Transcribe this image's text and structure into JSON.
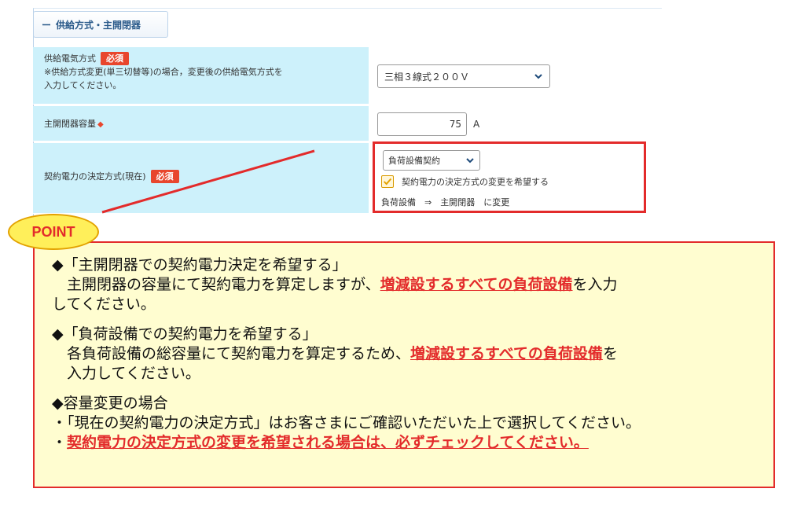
{
  "section": {
    "title": "供給方式・主開閉器",
    "collapse_symbol": "ー"
  },
  "rows": {
    "supply_method": {
      "label": "供給電気方式",
      "required": "必須",
      "note_line1": "※供給方式変更(単三切替等)の場合，変更後の供給電気方式を",
      "note_line2": "入力してください。",
      "select_value": "三相３線式２００Ｖ"
    },
    "main_switch_capacity": {
      "label": "主開閉器容量",
      "marker": "◆",
      "value": "75",
      "unit": "A"
    },
    "contract_method": {
      "label": "契約電力の決定方式(現在)",
      "required": "必須",
      "select_value": "負荷設備契約",
      "checkbox_label": "契約電力の決定方式の変更を希望する",
      "checkbox_checked": true,
      "change_text": "負荷設備　⇒　主開閉器　に変更"
    }
  },
  "point": {
    "badge": "POINT",
    "p1_heading": "◆「主開閉器での契約電力決定を希望する」",
    "p1_line_pre": "　主開閉器の容量にて契約電力を算定しますが、",
    "p1_highlight": "増減設するすべての負荷設備",
    "p1_line_post": "を入力",
    "p1_line2": "してください。",
    "p2_heading": "◆「負荷設備での契約電力を希望する」",
    "p2_line_pre": "　各負荷設備の総容量にて契約電力を算定するため、",
    "p2_highlight": "増減設するすべての負荷設備",
    "p2_line_post": "を",
    "p2_line2": "　入力してください。",
    "p3_heading": "◆容量変更の場合",
    "p3_line1": "・「現在の契約電力の決定方式」はお客さまにご確認いただいた上で選択してください。",
    "p3_line2_prefix": "・",
    "p3_line2_highlight": "契約電力の決定方式の変更を希望される場合は、必ずチェックしてください。"
  },
  "colors": {
    "accent_red": "#e32b2b",
    "label_bg": "#cdf1fb",
    "point_bg": "#fffdd0",
    "badge_bg": "#ffef5a"
  }
}
